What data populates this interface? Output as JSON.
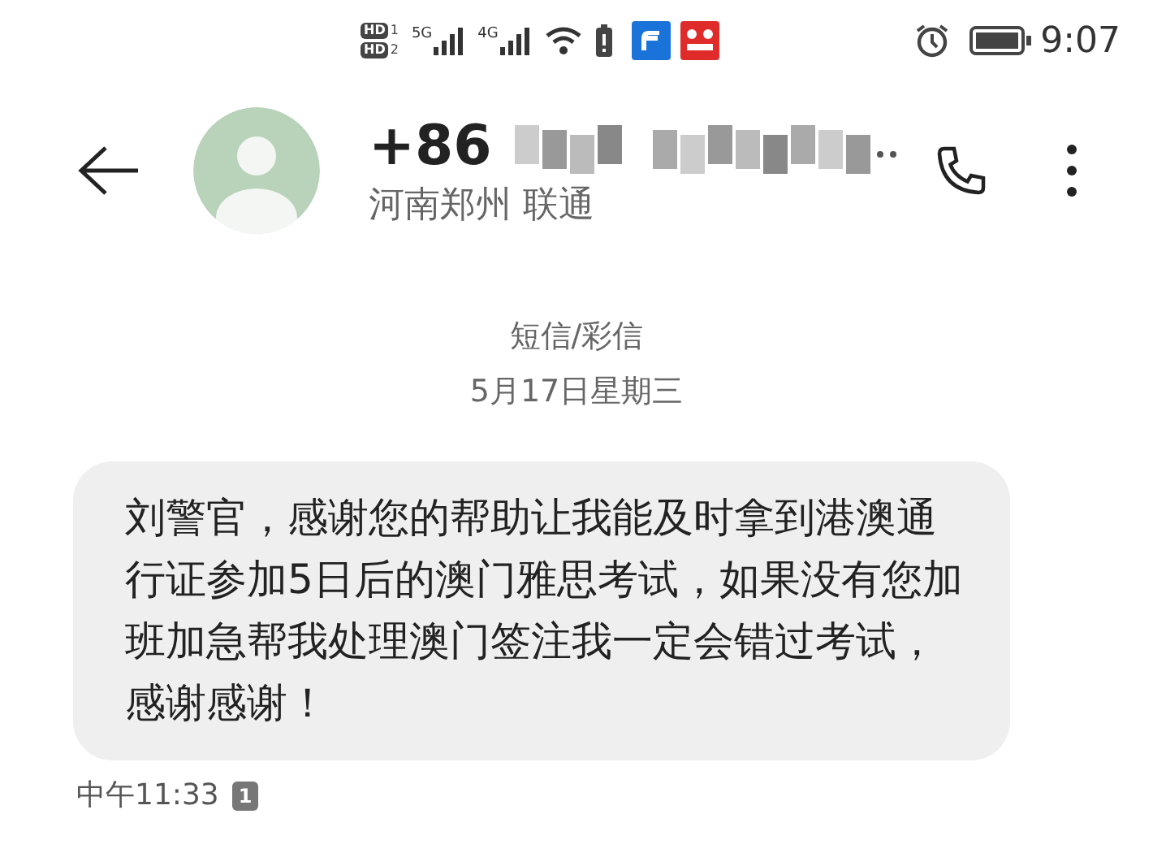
{
  "status_bar": {
    "sims": [
      {
        "badge": "HD",
        "slot": "1",
        "network": "5G"
      },
      {
        "badge": "HD",
        "slot": "2",
        "network": "4G"
      }
    ],
    "time": "9:07"
  },
  "header": {
    "country_code": "+86",
    "location": "河南郑州 联通"
  },
  "thread": {
    "channel": "短信/彩信",
    "date": "5月17日星期三"
  },
  "messages": [
    {
      "text": "刘警官，感谢您的帮助让我能及时拿到港澳通行证参加5日后的澳门雅思考试，如果没有您加班加急帮我处理澳门签注我一定会错过考试，感谢感谢！",
      "time": "中午11:33",
      "sim": "1"
    }
  ]
}
